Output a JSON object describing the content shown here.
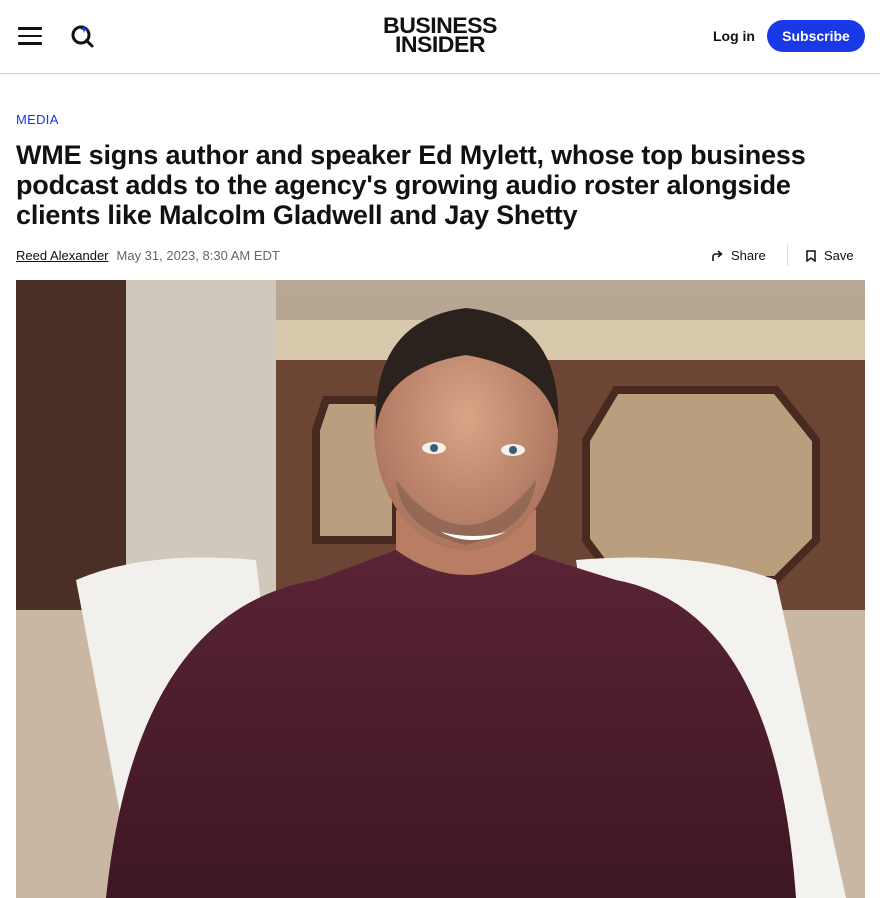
{
  "header": {
    "menu_icon": "hamburger-menu-icon",
    "search_icon": "search-icon",
    "logo_line1": "BUSINESS",
    "logo_line2": "INSIDER",
    "login_label": "Log in",
    "subscribe_label": "Subscribe",
    "accent_color": "#1938e6"
  },
  "article": {
    "category": "MEDIA",
    "headline": "WME signs author and speaker Ed Mylett, whose top business podcast adds to the agency's growing audio roster alongside clients like Malcolm Gladwell and Jay Shetty",
    "author": "Reed Alexander",
    "date": "May 31, 2023, 8:30 AM EDT",
    "share_label": "Share",
    "share_icon": "share-arrow-icon",
    "save_label": "Save",
    "save_icon": "bookmark-icon"
  }
}
